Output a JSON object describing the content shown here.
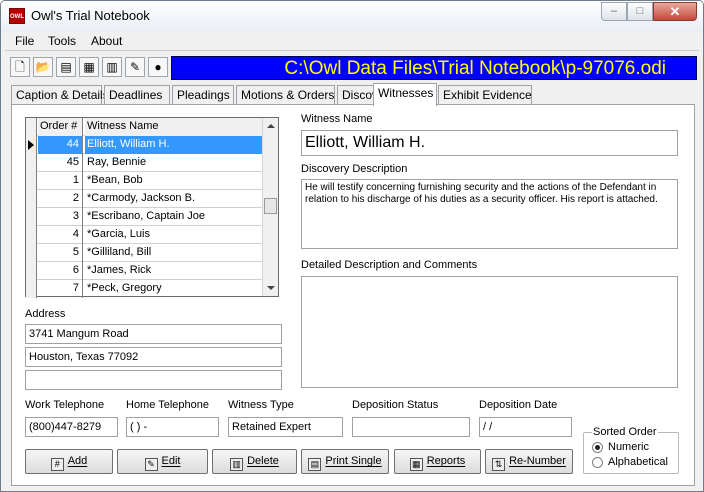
{
  "window": {
    "title": "Owl's Trial Notebook",
    "icon_text": "OWL",
    "controls": {
      "minimize": "–",
      "maximize": "□",
      "close": "✕"
    }
  },
  "menu": [
    "File",
    "Tools",
    "About"
  ],
  "toolbar": {
    "icons": [
      "new-file-icon",
      "open-folder-icon",
      "document-icon",
      "calendar-icon",
      "calculator-icon",
      "owl-icon",
      "globe-icon"
    ],
    "glyphs": [
      "🗋",
      "📂",
      "▤",
      "▦",
      "▥",
      "✎",
      "●"
    ],
    "path": "C:\\Owl Data Files\\Trial Notebook\\p-97076.odi"
  },
  "tabs": [
    "Caption & Details",
    "Deadlines",
    "Pleadings",
    "Motions & Orders",
    "Discovery",
    "Witnesses",
    "Exhibit Evidence"
  ],
  "active_tab": "Witnesses",
  "grid": {
    "headers": {
      "order": "Order #",
      "name": "Witness Name"
    },
    "rows": [
      {
        "order": "44",
        "name": "Elliott, William H.",
        "selected": true
      },
      {
        "order": "45",
        "name": "Ray, Bennie"
      },
      {
        "order": "1",
        "name": "*Bean, Bob"
      },
      {
        "order": "2",
        "name": "*Carmody, Jackson B."
      },
      {
        "order": "3",
        "name": "*Escribano, Captain Joe"
      },
      {
        "order": "4",
        "name": "*Garcia, Luis"
      },
      {
        "order": "5",
        "name": "*Gilliland, Bill"
      },
      {
        "order": "6",
        "name": "*James, Rick"
      },
      {
        "order": "7",
        "name": "*Peck, Gregory"
      }
    ]
  },
  "address": {
    "label": "Address",
    "line1": "3741 Mangum Road",
    "line2": "Houston, Texas 77092",
    "line3": ""
  },
  "witness": {
    "name_label": "Witness Name",
    "name": "Elliott, William H.",
    "discovery_label": "Discovery Description",
    "discovery": "He will testify concerning furnishing security and the actions of the Defendant in relation to his discharge of his duties as a security officer. His report is attached.",
    "comments_label": "Detailed Description and Comments",
    "comments": ""
  },
  "details": {
    "work_phone_label": "Work Telephone",
    "work_phone": "(800)447-8279",
    "home_phone_label": "Home Telephone",
    "home_phone": "(   )    -",
    "type_label": "Witness Type",
    "type": "Retained Expert",
    "depo_status_label": "Deposition Status",
    "depo_status": "",
    "depo_date_label": "Deposition Date",
    "depo_date": "  /  /"
  },
  "buttons": {
    "add": "Add",
    "edit": "Edit",
    "delete": "Delete",
    "print": "Print Single",
    "reports": "Reports",
    "renumber": "Re-Number"
  },
  "sorted_order": {
    "legend": "Sorted Order",
    "options": [
      "Numeric",
      "Alphabetical"
    ],
    "selected": "Numeric"
  }
}
